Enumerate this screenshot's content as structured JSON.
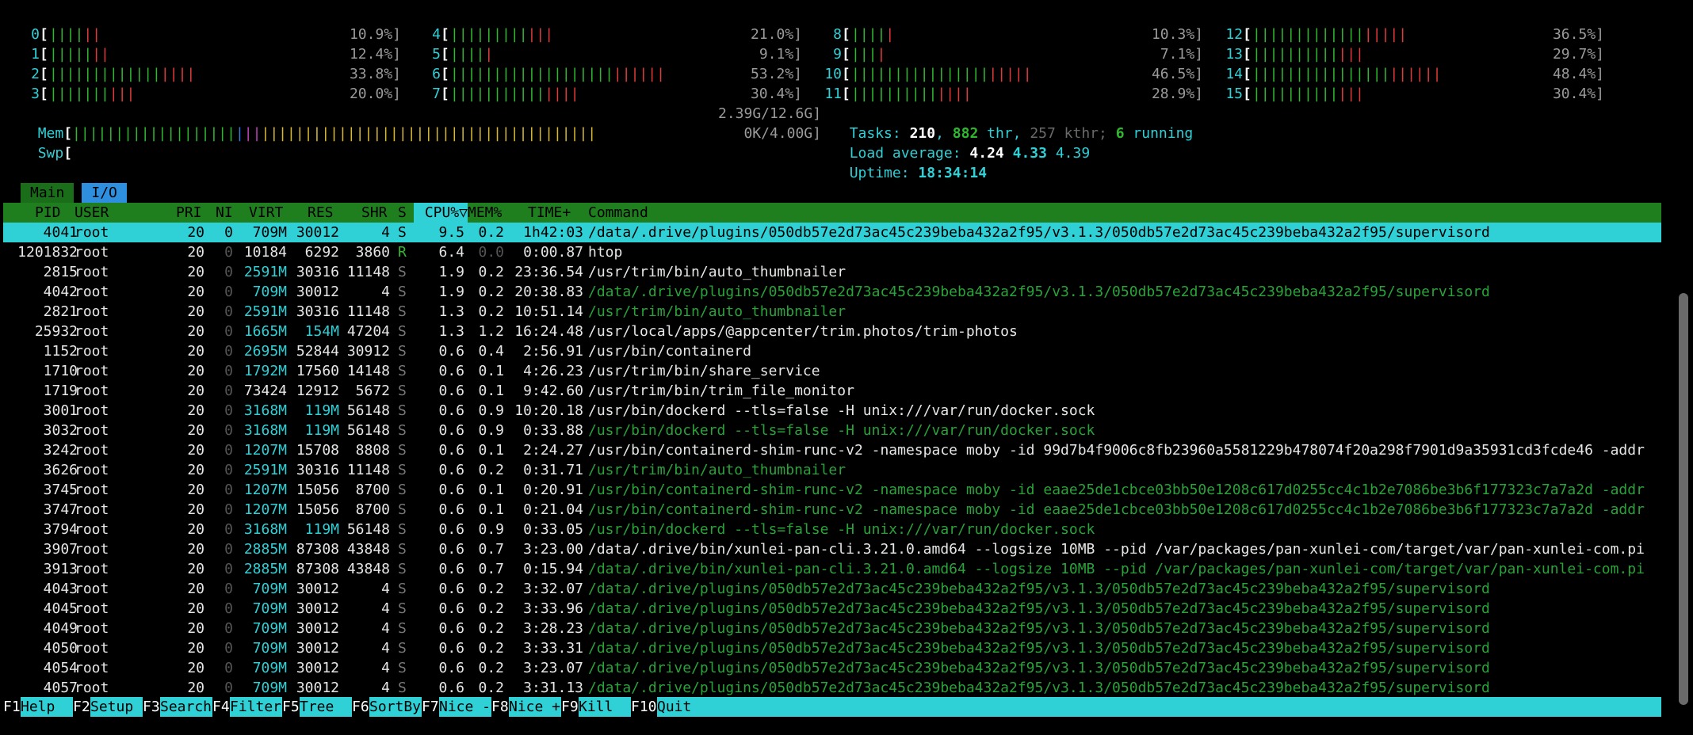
{
  "cpus": [
    {
      "id": "0",
      "bars": "||||||",
      "pct": "10.9%]"
    },
    {
      "id": "1",
      "bars": "|||||||",
      "pct": "12.4%]"
    },
    {
      "id": "2",
      "bars": "|||||||||||||||||",
      "pct": "33.8%]"
    },
    {
      "id": "3",
      "bars": "||||||||||",
      "pct": "20.0%]"
    },
    {
      "id": "4",
      "bars": "||||||||||||",
      "pct": "21.0%]"
    },
    {
      "id": "5",
      "bars": "|||||",
      "pct": "9.1%]"
    },
    {
      "id": "6",
      "bars": "|||||||||||||||||||||||||",
      "pct": "53.2%]"
    },
    {
      "id": "7",
      "bars": "|||||||||||||||",
      "pct": "30.4%]"
    },
    {
      "id": "8",
      "bars": "|||||",
      "pct": "10.3%]"
    },
    {
      "id": "9",
      "bars": "||||",
      "pct": "7.1%]"
    },
    {
      "id": "10",
      "bars": "|||||||||||||||||||||",
      "pct": "46.5%]"
    },
    {
      "id": "11",
      "bars": "||||||||||||||",
      "pct": "28.9%]"
    },
    {
      "id": "12",
      "bars": "||||||||||||||||||",
      "pct": "36.5%]"
    },
    {
      "id": "13",
      "bars": "|||||||||||||",
      "pct": "29.7%]"
    },
    {
      "id": "14",
      "bars": "||||||||||||||||||||||",
      "pct": "48.4%]"
    },
    {
      "id": "15",
      "bars": "|||||||||||||",
      "pct": "30.4%]"
    }
  ],
  "mem": {
    "label": "Mem",
    "bars_green": "|||||||||||||||||||",
    "bars_blue": "|",
    "bars_magenta": "||",
    "bars_yellow": "|||||||||||||||||||||||||||||||||||||||",
    "value": "2.39G/12.6G]"
  },
  "swp": {
    "label": "Swp",
    "value": "0K/4.00G]"
  },
  "tasks": {
    "label": "Tasks:",
    "count": "210",
    "thr": "882",
    "thr_label": "thr,",
    "kthr": "257 kthr;",
    "running": "6",
    "running_label": "running"
  },
  "load": {
    "label": "Load average:",
    "l1": "4.24",
    "l5": "4.33",
    "l15": "4.39"
  },
  "uptime": {
    "label": "Uptime:",
    "value": "18:34:14"
  },
  "tabs": {
    "main": "Main",
    "io": "I/O"
  },
  "header": {
    "pid": "PID",
    "user": "USER",
    "pri": "PRI",
    "ni": "NI",
    "virt": "VIRT",
    "res": "RES",
    "shr": "SHR",
    "s": "S",
    "cpu": "CPU%▽",
    "mem": "MEM%",
    "time": "TIME+",
    "cmd": "Command"
  },
  "processes": [
    {
      "pid": "4041",
      "user": "root",
      "pri": "20",
      "ni": "0",
      "virt": "709M",
      "res": "30012",
      "shr": "4",
      "s": "S",
      "cpu": "9.5",
      "mem": "0.2",
      "time": "1h42:03",
      "cmd": "/data/.drive/plugins/050db57e2d73ac45c239beba432a2f95/v3.1.3/050db57e2d73ac45c239beba432a2f95/supervisord",
      "thread": false,
      "selected": true
    },
    {
      "pid": "1201832",
      "user": "root",
      "pri": "20",
      "ni": "0",
      "virt": "10184",
      "res": "6292",
      "shr": "3860",
      "s": "R",
      "cpu": "6.4",
      "mem": "0.0",
      "time": "0:00.87",
      "cmd": "htop",
      "thread": false
    },
    {
      "pid": "2815",
      "user": "root",
      "pri": "20",
      "ni": "0",
      "virt": "2591M",
      "res": "30316",
      "shr": "11148",
      "s": "S",
      "cpu": "1.9",
      "mem": "0.2",
      "time": "23:36.54",
      "cmd": "/usr/trim/bin/auto_thumbnailer",
      "thread": false
    },
    {
      "pid": "4042",
      "user": "root",
      "pri": "20",
      "ni": "0",
      "virt": "709M",
      "res": "30012",
      "shr": "4",
      "s": "S",
      "cpu": "1.9",
      "mem": "0.2",
      "time": "20:38.83",
      "cmd": "/data/.drive/plugins/050db57e2d73ac45c239beba432a2f95/v3.1.3/050db57e2d73ac45c239beba432a2f95/supervisord",
      "thread": true
    },
    {
      "pid": "2821",
      "user": "root",
      "pri": "20",
      "ni": "0",
      "virt": "2591M",
      "res": "30316",
      "shr": "11148",
      "s": "S",
      "cpu": "1.3",
      "mem": "0.2",
      "time": "10:51.14",
      "cmd": "/usr/trim/bin/auto_thumbnailer",
      "thread": true
    },
    {
      "pid": "25932",
      "user": "root",
      "pri": "20",
      "ni": "0",
      "virt": "1665M",
      "res": "154M",
      "shr": "47204",
      "s": "S",
      "cpu": "1.3",
      "mem": "1.2",
      "time": "16:24.48",
      "cmd": "/usr/local/apps/@appcenter/trim.photos/trim-photos",
      "thread": false
    },
    {
      "pid": "1152",
      "user": "root",
      "pri": "20",
      "ni": "0",
      "virt": "2695M",
      "res": "52844",
      "shr": "30912",
      "s": "S",
      "cpu": "0.6",
      "mem": "0.4",
      "time": "2:56.91",
      "cmd": "/usr/bin/containerd",
      "thread": false
    },
    {
      "pid": "1710",
      "user": "root",
      "pri": "20",
      "ni": "0",
      "virt": "1792M",
      "res": "17560",
      "shr": "14148",
      "s": "S",
      "cpu": "0.6",
      "mem": "0.1",
      "time": "4:26.23",
      "cmd": "/usr/trim/bin/share_service",
      "thread": false
    },
    {
      "pid": "1719",
      "user": "root",
      "pri": "20",
      "ni": "0",
      "virt": "73424",
      "res": "12912",
      "shr": "5672",
      "s": "S",
      "cpu": "0.6",
      "mem": "0.1",
      "time": "9:42.60",
      "cmd": "/usr/trim/bin/trim_file_monitor",
      "thread": false
    },
    {
      "pid": "3001",
      "user": "root",
      "pri": "20",
      "ni": "0",
      "virt": "3168M",
      "res": "119M",
      "shr": "56148",
      "s": "S",
      "cpu": "0.6",
      "mem": "0.9",
      "time": "10:20.18",
      "cmd": "/usr/bin/dockerd --tls=false -H unix:///var/run/docker.sock",
      "thread": false
    },
    {
      "pid": "3032",
      "user": "root",
      "pri": "20",
      "ni": "0",
      "virt": "3168M",
      "res": "119M",
      "shr": "56148",
      "s": "S",
      "cpu": "0.6",
      "mem": "0.9",
      "time": "0:33.88",
      "cmd": "/usr/bin/dockerd --tls=false -H unix:///var/run/docker.sock",
      "thread": true
    },
    {
      "pid": "3242",
      "user": "root",
      "pri": "20",
      "ni": "0",
      "virt": "1207M",
      "res": "15708",
      "shr": "8808",
      "s": "S",
      "cpu": "0.6",
      "mem": "0.1",
      "time": "2:24.27",
      "cmd": "/usr/bin/containerd-shim-runc-v2 -namespace moby -id 99d7b4f9006c8fb23960a5581229b478074f20a298f7901d9a35931cd3fcde46 -addr",
      "thread": false
    },
    {
      "pid": "3626",
      "user": "root",
      "pri": "20",
      "ni": "0",
      "virt": "2591M",
      "res": "30316",
      "shr": "11148",
      "s": "S",
      "cpu": "0.6",
      "mem": "0.2",
      "time": "0:31.71",
      "cmd": "/usr/trim/bin/auto_thumbnailer",
      "thread": true
    },
    {
      "pid": "3745",
      "user": "root",
      "pri": "20",
      "ni": "0",
      "virt": "1207M",
      "res": "15056",
      "shr": "8700",
      "s": "S",
      "cpu": "0.6",
      "mem": "0.1",
      "time": "0:20.91",
      "cmd": "/usr/bin/containerd-shim-runc-v2 -namespace moby -id eaae25de1cbce03bb50e1208c617d0255cc4c1b2e7086be3b6f177323c7a7a2d -addr",
      "thread": true
    },
    {
      "pid": "3747",
      "user": "root",
      "pri": "20",
      "ni": "0",
      "virt": "1207M",
      "res": "15056",
      "shr": "8700",
      "s": "S",
      "cpu": "0.6",
      "mem": "0.1",
      "time": "0:21.04",
      "cmd": "/usr/bin/containerd-shim-runc-v2 -namespace moby -id eaae25de1cbce03bb50e1208c617d0255cc4c1b2e7086be3b6f177323c7a7a2d -addr",
      "thread": true
    },
    {
      "pid": "3794",
      "user": "root",
      "pri": "20",
      "ni": "0",
      "virt": "3168M",
      "res": "119M",
      "shr": "56148",
      "s": "S",
      "cpu": "0.6",
      "mem": "0.9",
      "time": "0:33.05",
      "cmd": "/usr/bin/dockerd --tls=false -H unix:///var/run/docker.sock",
      "thread": true
    },
    {
      "pid": "3907",
      "user": "root",
      "pri": "20",
      "ni": "0",
      "virt": "2885M",
      "res": "87308",
      "shr": "43848",
      "s": "S",
      "cpu": "0.6",
      "mem": "0.7",
      "time": "3:23.00",
      "cmd": "/data/.drive/bin/xunlei-pan-cli.3.21.0.amd64 --logsize 10MB --pid /var/packages/pan-xunlei-com/target/var/pan-xunlei-com.pi",
      "thread": false
    },
    {
      "pid": "3913",
      "user": "root",
      "pri": "20",
      "ni": "0",
      "virt": "2885M",
      "res": "87308",
      "shr": "43848",
      "s": "S",
      "cpu": "0.6",
      "mem": "0.7",
      "time": "0:15.94",
      "cmd": "/data/.drive/bin/xunlei-pan-cli.3.21.0.amd64 --logsize 10MB --pid /var/packages/pan-xunlei-com/target/var/pan-xunlei-com.pi",
      "thread": true
    },
    {
      "pid": "4043",
      "user": "root",
      "pri": "20",
      "ni": "0",
      "virt": "709M",
      "res": "30012",
      "shr": "4",
      "s": "S",
      "cpu": "0.6",
      "mem": "0.2",
      "time": "3:32.07",
      "cmd": "/data/.drive/plugins/050db57e2d73ac45c239beba432a2f95/v3.1.3/050db57e2d73ac45c239beba432a2f95/supervisord",
      "thread": true
    },
    {
      "pid": "4045",
      "user": "root",
      "pri": "20",
      "ni": "0",
      "virt": "709M",
      "res": "30012",
      "shr": "4",
      "s": "S",
      "cpu": "0.6",
      "mem": "0.2",
      "time": "3:33.96",
      "cmd": "/data/.drive/plugins/050db57e2d73ac45c239beba432a2f95/v3.1.3/050db57e2d73ac45c239beba432a2f95/supervisord",
      "thread": true
    },
    {
      "pid": "4049",
      "user": "root",
      "pri": "20",
      "ni": "0",
      "virt": "709M",
      "res": "30012",
      "shr": "4",
      "s": "S",
      "cpu": "0.6",
      "mem": "0.2",
      "time": "3:28.23",
      "cmd": "/data/.drive/plugins/050db57e2d73ac45c239beba432a2f95/v3.1.3/050db57e2d73ac45c239beba432a2f95/supervisord",
      "thread": true
    },
    {
      "pid": "4050",
      "user": "root",
      "pri": "20",
      "ni": "0",
      "virt": "709M",
      "res": "30012",
      "shr": "4",
      "s": "S",
      "cpu": "0.6",
      "mem": "0.2",
      "time": "3:33.31",
      "cmd": "/data/.drive/plugins/050db57e2d73ac45c239beba432a2f95/v3.1.3/050db57e2d73ac45c239beba432a2f95/supervisord",
      "thread": true
    },
    {
      "pid": "4054",
      "user": "root",
      "pri": "20",
      "ni": "0",
      "virt": "709M",
      "res": "30012",
      "shr": "4",
      "s": "S",
      "cpu": "0.6",
      "mem": "0.2",
      "time": "3:23.07",
      "cmd": "/data/.drive/plugins/050db57e2d73ac45c239beba432a2f95/v3.1.3/050db57e2d73ac45c239beba432a2f95/supervisord",
      "thread": true
    },
    {
      "pid": "4057",
      "user": "root",
      "pri": "20",
      "ni": "0",
      "virt": "709M",
      "res": "30012",
      "shr": "4",
      "s": "S",
      "cpu": "0.6",
      "mem": "0.2",
      "time": "3:31.13",
      "cmd": "/data/.drive/plugins/050db57e2d73ac45c239beba432a2f95/v3.1.3/050db57e2d73ac45c239beba432a2f95/supervisord",
      "thread": true
    }
  ],
  "footer": [
    {
      "key": "F1",
      "label": "Help"
    },
    {
      "key": "F2",
      "label": "Setup"
    },
    {
      "key": "F3",
      "label": "Search"
    },
    {
      "key": "F4",
      "label": "Filter"
    },
    {
      "key": "F5",
      "label": "Tree"
    },
    {
      "key": "F6",
      "label": "SortBy"
    },
    {
      "key": "F7",
      "label": "Nice -"
    },
    {
      "key": "F8",
      "label": "Nice +"
    },
    {
      "key": "F9",
      "label": "Kill"
    },
    {
      "key": "F10",
      "label": "Quit"
    }
  ],
  "colors": {
    "cyan": "#2fd0d6",
    "green": "#2fb82f",
    "red": "#e03a3a",
    "header_bg": "#1f7f1f",
    "selected_bg": "#2fd0d6"
  }
}
